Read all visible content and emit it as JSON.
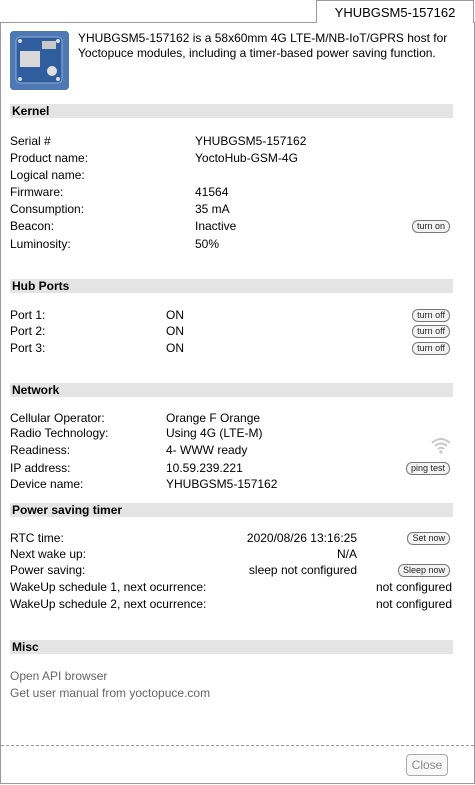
{
  "window": {
    "tab_title": "YHUBGSM5-157162",
    "close_label": "Close"
  },
  "header": {
    "description": "YHUBGSM5-157162 is a 58x60mm 4G LTE-M/NB-IoT/GPRS host for Yoctopuce modules, including a timer-based power saving function."
  },
  "kernel": {
    "title": "Kernel",
    "rows": [
      {
        "label": "Serial #",
        "value": "YHUBGSM5-157162"
      },
      {
        "label": "Product name:",
        "value": "YoctoHub-GSM-4G"
      },
      {
        "label": "Logical name:",
        "value": ""
      },
      {
        "label": "Firmware:",
        "value": "41564"
      },
      {
        "label": "Consumption:",
        "value": "35 mA"
      },
      {
        "label": "Beacon:",
        "value": "Inactive",
        "button": "turn on"
      },
      {
        "label": "Luminosity:",
        "value": "50%"
      }
    ]
  },
  "hub_ports": {
    "title": "Hub Ports",
    "rows": [
      {
        "label": "Port 1:",
        "value": "ON",
        "button": "turn off"
      },
      {
        "label": "Port 2:",
        "value": "ON",
        "button": "turn off"
      },
      {
        "label": "Port 3:",
        "value": "ON",
        "button": "turn off"
      }
    ]
  },
  "network": {
    "title": "Network",
    "rows": [
      {
        "label": "Cellular Operator:",
        "value": "Orange F Orange"
      },
      {
        "label": "Radio Technology:",
        "value": "Using 4G (LTE-M)"
      },
      {
        "label": "Readiness:",
        "value": "4- WWW ready",
        "icon": "wifi-signal-icon"
      },
      {
        "label": "IP address:",
        "value": "10.59.239.221",
        "button": "ping test"
      },
      {
        "label": "Device name:",
        "value": "YHUBGSM5-157162"
      }
    ]
  },
  "power_timer": {
    "title": "Power saving timer",
    "rows": [
      {
        "label": "RTC time:",
        "value": "2020/08/26 13:16:25",
        "button": "Set now"
      },
      {
        "label": "Next wake up:",
        "value": "N/A"
      },
      {
        "label": "Power saving:",
        "value": "sleep not configured",
        "button": "Sleep now"
      },
      {
        "label": "WakeUp schedule 1, next ocurrence:",
        "value": "not configured"
      },
      {
        "label": "WakeUp schedule 2, next ocurrence:",
        "value": "not configured"
      }
    ]
  },
  "misc": {
    "title": "Misc",
    "links": [
      "Open API browser",
      "Get user manual from yoctopuce.com"
    ]
  }
}
